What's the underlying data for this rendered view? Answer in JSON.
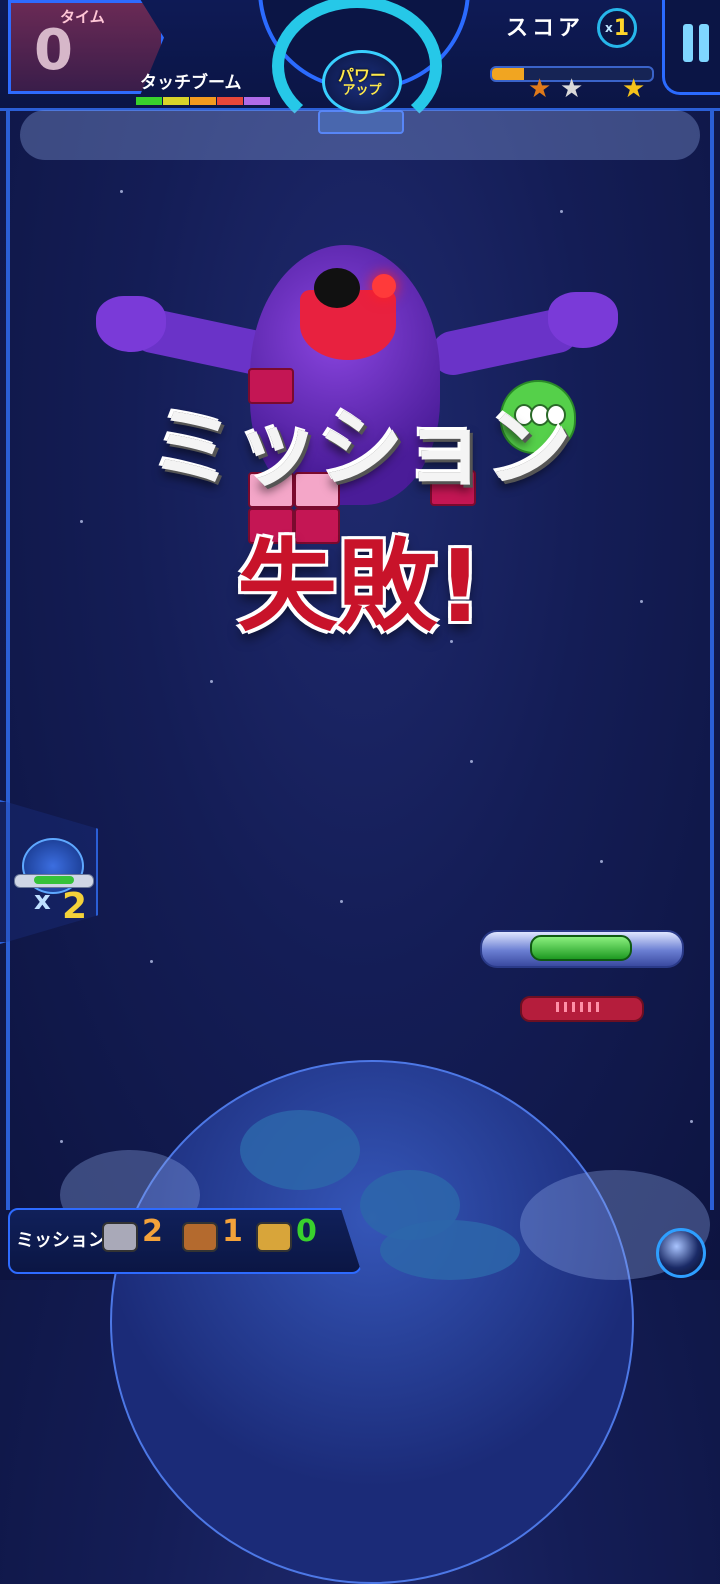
{
  "hud": {
    "time_label": "タイム",
    "time_value": "0",
    "touch_boom_label": "タッチブーム",
    "touch_boom_colors": [
      "#39d12d",
      "#d8d42a",
      "#f29a1f",
      "#e8473a",
      "#b06be8"
    ],
    "power_up_label_line1": "パワー",
    "power_up_label_line2": "アップ",
    "score_label": "スコア",
    "multiplier_prefix": "x",
    "multiplier_value": "1",
    "score_progress_fraction": 0.2,
    "rank_stars": [
      {
        "color": "#e07a1a",
        "filled": true
      },
      {
        "color": "#d9d9d9",
        "filled": true
      },
      {
        "color": "#f4c21b",
        "filled": true
      }
    ],
    "pause_icon": "pause-icon"
  },
  "overlay": {
    "mission_text": "ミッション",
    "fail_text": "失敗!"
  },
  "shield_item": {
    "icon": "shield-icon",
    "count_prefix": "x",
    "count": "2"
  },
  "footer": {
    "mission_label": "ミッション",
    "targets": [
      {
        "icon": "gray-cat-icon",
        "count": "2",
        "color": "#f4a23a"
      },
      {
        "icon": "brown-cat-icon",
        "count": "1",
        "color": "#f4a23a"
      },
      {
        "icon": "yellow-cat-icon",
        "count": "0",
        "color": "#39d12d"
      }
    ],
    "orb_icon": "orb-icon"
  },
  "colors": {
    "accent_blue": "#2b6bff",
    "fail_red": "#c8132a",
    "monster_purple": "#6a33c8"
  }
}
